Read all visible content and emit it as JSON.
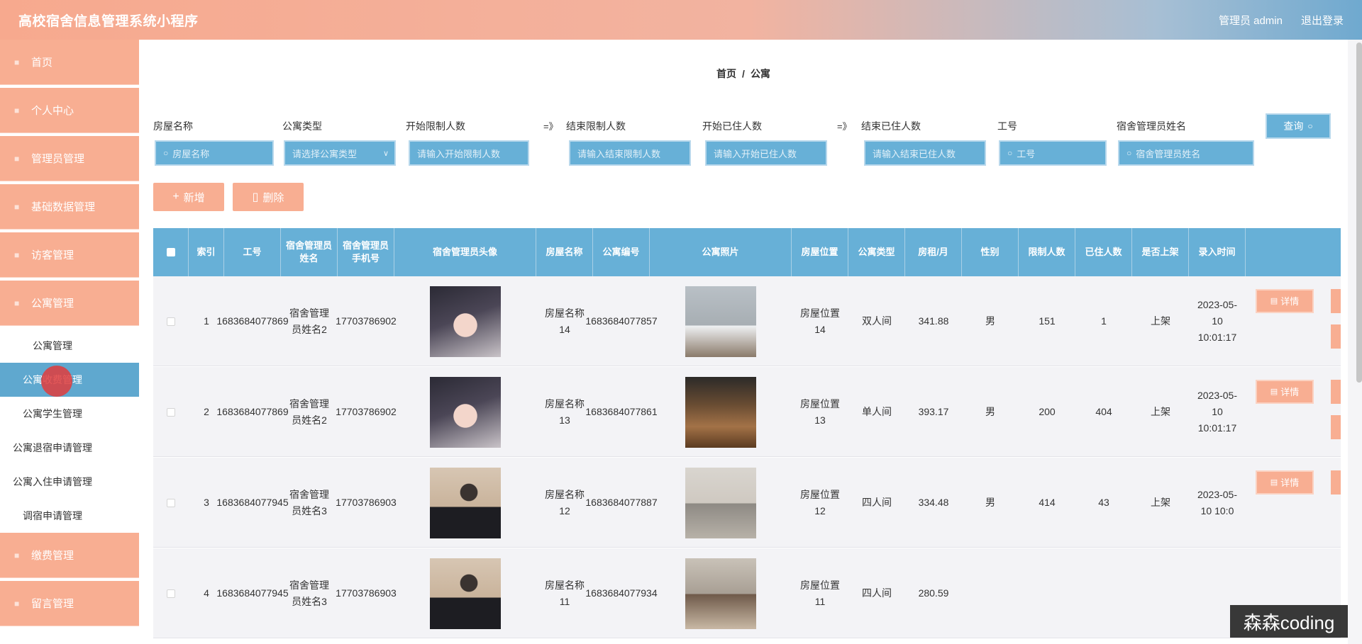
{
  "header": {
    "title": "高校宿舍信息管理系统小程序",
    "admin_label": "管理员 admin",
    "logout": "退出登录"
  },
  "sidebar": {
    "items": [
      {
        "label": "首页",
        "icon": "home-icon"
      },
      {
        "label": "个人中心",
        "icon": "user-icon"
      },
      {
        "label": "管理员管理",
        "icon": "admin-icon"
      },
      {
        "label": "基础数据管理",
        "icon": "data-icon"
      },
      {
        "label": "访客管理",
        "icon": "visitor-icon"
      },
      {
        "label": "公寓管理",
        "icon": "apartment-icon"
      }
    ],
    "subitems": [
      {
        "label": "公寓管理"
      },
      {
        "label": "公寓收费管理"
      },
      {
        "label": "公寓学生管理"
      },
      {
        "label": "公寓退宿申请管理"
      },
      {
        "label": "公寓入住申请管理"
      },
      {
        "label": "调宿申请管理"
      }
    ],
    "items_bottom": [
      {
        "label": "缴费管理",
        "icon": "payment-icon"
      },
      {
        "label": "留言管理",
        "icon": "message-icon"
      }
    ]
  },
  "breadcrumb": {
    "home": "首页",
    "sep": "/",
    "current": "公寓"
  },
  "filters": {
    "house_name": {
      "label": "房屋名称",
      "placeholder": "房屋名称"
    },
    "apt_type": {
      "label": "公寓类型",
      "placeholder": "请选择公寓类型"
    },
    "start_limit": {
      "label": "开始限制人数",
      "placeholder": "请输入开始限制人数"
    },
    "arrow1": "=》",
    "end_limit": {
      "label": "结束限制人数",
      "placeholder": "请输入结束限制人数"
    },
    "start_occ": {
      "label": "开始已住人数",
      "placeholder": "请输入开始已住人数"
    },
    "arrow2": "=》",
    "end_occ": {
      "label": "结束已住人数",
      "placeholder": "请输入结束已住人数"
    },
    "job_no": {
      "label": "工号",
      "placeholder": "工号"
    },
    "manager": {
      "label": "宿舍管理员姓名",
      "placeholder": "宿舍管理员姓名"
    },
    "query": "查询"
  },
  "actions": {
    "add": "新增",
    "delete": "删除"
  },
  "table": {
    "headers": [
      "索引",
      "工号",
      "宿舍管理员姓名",
      "宿舍管理员手机号",
      "宿舍管理员头像",
      "房屋名称",
      "公寓编号",
      "公寓照片",
      "房屋位置",
      "公寓类型",
      "房租/月",
      "性别",
      "限制人数",
      "已住人数",
      "是否上架",
      "录入时间"
    ],
    "detail_label": "详情",
    "rows": [
      {
        "idx": "1",
        "job": "1683684077869",
        "name": "宿舍管理员姓名2",
        "phone": "17703786902",
        "house": "房屋名称14",
        "code": "1683684077857",
        "loc": "房屋位置14",
        "type": "双人间",
        "rent": "341.88",
        "sex": "男",
        "limit": "151",
        "occ": "1",
        "shelf": "上架",
        "time": "2023-05-10 10:01:17"
      },
      {
        "idx": "2",
        "job": "1683684077869",
        "name": "宿舍管理员姓名2",
        "phone": "17703786902",
        "house": "房屋名称13",
        "code": "1683684077861",
        "loc": "房屋位置13",
        "type": "单人间",
        "rent": "393.17",
        "sex": "男",
        "limit": "200",
        "occ": "404",
        "shelf": "上架",
        "time": "2023-05-10 10:01:17"
      },
      {
        "idx": "3",
        "job": "1683684077945",
        "name": "宿舍管理员姓名3",
        "phone": "17703786903",
        "house": "房屋名称12",
        "code": "1683684077887",
        "loc": "房屋位置12",
        "type": "四人间",
        "rent": "334.48",
        "sex": "男",
        "limit": "414",
        "occ": "43",
        "shelf": "上架",
        "time": "2023-05-10 10:0"
      },
      {
        "idx": "4",
        "job": "1683684077945",
        "name": "宿舍管理员姓名3",
        "phone": "17703786903",
        "house": "房屋名称11",
        "code": "1683684077934",
        "loc": "房屋位置11",
        "type": "四人间",
        "rent": "280.59",
        "sex": "",
        "limit": "",
        "occ": "",
        "shelf": "",
        "time": ""
      }
    ]
  },
  "watermark": "森森coding"
}
